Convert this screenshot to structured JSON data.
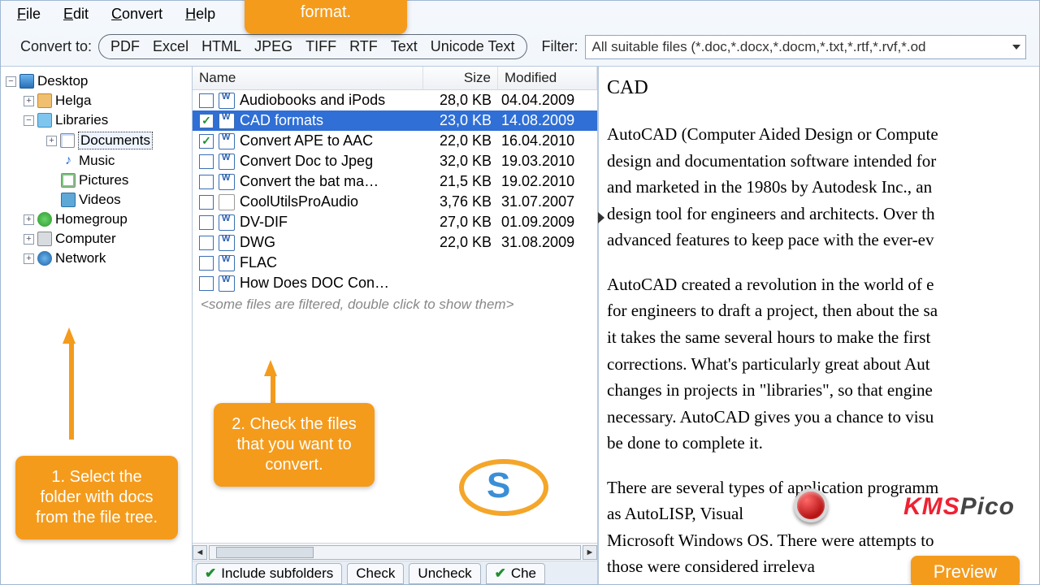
{
  "menu": {
    "file": "File",
    "edit": "Edit",
    "convert": "Convert",
    "help": "Help"
  },
  "toolbar": {
    "convert_to": "Convert to:",
    "formats": [
      "PDF",
      "Excel",
      "HTML",
      "JPEG",
      "TIFF",
      "RTF",
      "Text",
      "Unicode Text"
    ],
    "filter_label": "Filter:",
    "filter_value": "All suitable files (*.doc,*.docx,*.docm,*.txt,*.rtf,*.rvf,*.od"
  },
  "tree": {
    "desktop": "Desktop",
    "helga": "Helga",
    "libraries": "Libraries",
    "documents": "Documents",
    "music": "Music",
    "pictures": "Pictures",
    "videos": "Videos",
    "homegroup": "Homegroup",
    "computer": "Computer",
    "network": "Network"
  },
  "cols": {
    "name": "Name",
    "size": "Size",
    "modified": "Modified"
  },
  "files": [
    {
      "chk": false,
      "name": "Audiobooks and iPods",
      "size": "28,0 KB",
      "mod": "04.04.2009",
      "t": "w"
    },
    {
      "chk": true,
      "name": "CAD formats",
      "size": "23,0 KB",
      "mod": "14.08.2009",
      "t": "w",
      "sel": true
    },
    {
      "chk": true,
      "name": "Convert APE to AAC",
      "size": "22,0 KB",
      "mod": "16.04.2010",
      "t": "w"
    },
    {
      "chk": false,
      "name": "Convert Doc to Jpeg",
      "size": "32,0 KB",
      "mod": "19.03.2010",
      "t": "w"
    },
    {
      "chk": false,
      "name": "Convert the bat ma…",
      "size": "21,5 KB",
      "mod": "19.02.2010",
      "t": "w"
    },
    {
      "chk": false,
      "name": "CoolUtilsProAudio",
      "size": "3,76 KB",
      "mod": "31.07.2007",
      "t": "txt"
    },
    {
      "chk": false,
      "name": "DV-DIF",
      "size": "27,0 KB",
      "mod": "01.09.2009",
      "t": "w"
    },
    {
      "chk": false,
      "name": "DWG",
      "size": "22,0 KB",
      "mod": "31.08.2009",
      "t": "w"
    },
    {
      "chk": false,
      "name": "FLAC",
      "size": "",
      "mod": "",
      "t": "w"
    },
    {
      "chk": false,
      "name": "How Does DOC Con…",
      "size": "",
      "mod": "",
      "t": "w"
    }
  ],
  "filtered_note": "<some files are filtered, double click to show them>",
  "bottom": {
    "include": "Include subfolders",
    "check": "Check",
    "uncheck": "Uncheck",
    "che": "Che"
  },
  "preview": {
    "title": "CAD",
    "p1a": "AutoCAD (Computer Aided Design or Compute",
    "p1b": "design and documentation software intended for",
    "p1c": "and marketed in the 1980s by Autodesk Inc., an",
    "p1d": "design tool for engineers and architects. Over th",
    "p1e": "advanced features to keep pace with the ever-ev",
    "p2a": "AutoCAD created a revolution in the world of e",
    "p2b": "for engineers to draft a project, then about the sa",
    "p2c": "it takes the same several hours to make the first ",
    "p2d": "corrections. What's particularly great about Aut",
    "p2e": "changes in projects in \"libraries\", so that engine",
    "p2f": "necessary. AutoCAD gives you a chance to visu",
    "p2g": "be done to complete it.",
    "p3a": "There are several types of application programm",
    "p3b": "as AutoLISP, Visual",
    "p3c": "Microsoft Windows OS. There were attempts to",
    "p3d": "those were considered irreleva"
  },
  "callouts": {
    "c1": "1. Select the folder with docs from the file tree.",
    "c2": "2. Check the files that you want to convert.",
    "c3": "format.",
    "preview": "Preview"
  },
  "watermark": "KMSPico"
}
